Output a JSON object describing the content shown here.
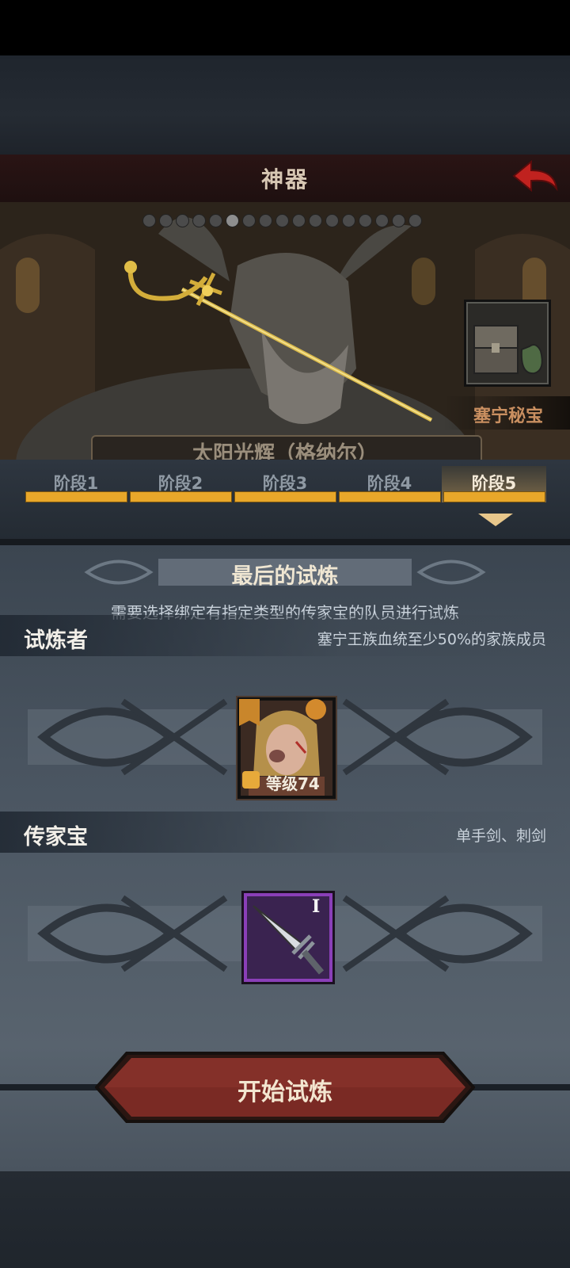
{
  "header": {
    "title": "神器"
  },
  "hero": {
    "pager": {
      "count": 17,
      "active_index": 5
    },
    "treasure_label": "塞宁秘宝",
    "artifact_name": "太阳光辉（格纳尔）"
  },
  "stages": {
    "tabs": [
      {
        "label": "阶段1"
      },
      {
        "label": "阶段2"
      },
      {
        "label": "阶段3"
      },
      {
        "label": "阶段4"
      },
      {
        "label": "阶段5"
      }
    ],
    "active_index": 4
  },
  "trial": {
    "title": "最后的试炼",
    "description": "需要选择绑定有指定类型的传家宝的队员进行试炼",
    "trialist": {
      "heading": "试炼者",
      "requirement": "塞宁王族血统至少50%的家族成员",
      "level_label": "等级74"
    },
    "heirloom": {
      "heading": "传家宝",
      "requirement": "单手剑、刺剑",
      "tier": "I"
    },
    "start_button": "开始试炼"
  },
  "colors": {
    "accent_orange": "#e8a72a",
    "button_red": "#7a2a24",
    "heirloom_purple": "#8a3fb8"
  }
}
